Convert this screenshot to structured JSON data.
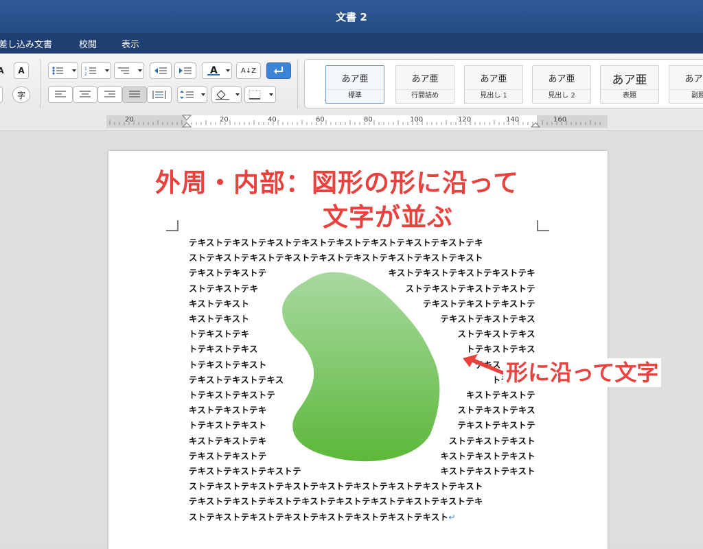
{
  "window": {
    "title": "文書 2"
  },
  "menu": {
    "tabs": [
      "差し込み文書",
      "校閲",
      "表示"
    ]
  },
  "ribbon": {
    "text_box_glyph": "A",
    "char_glyph": "字",
    "sort_glyph": "A↓Z"
  },
  "styles": [
    {
      "preview": "あア亜",
      "name": "標準",
      "selected": true
    },
    {
      "preview": "あア亜",
      "name": "行間詰め"
    },
    {
      "preview": "あア亜",
      "name": "見出し 1"
    },
    {
      "preview": "あア亜",
      "name": "見出し 2"
    },
    {
      "preview": "あア亜",
      "name": "表題"
    },
    {
      "preview": "あア亜",
      "name": "副題"
    }
  ],
  "ruler": {
    "numbers": [
      "20",
      "20",
      "40",
      "60",
      "80",
      "100",
      "120",
      "140",
      "160"
    ]
  },
  "document": {
    "heading_line1": "外周・内部：図形の形に沿って",
    "heading_line2": "文字が並ぶ",
    "shape_color_top": "#a8d9a0",
    "shape_color_bottom": "#5cb83a",
    "lines": [
      [
        "テキストテキストテキストテキストテキストテキストテキストテキストテキ",
        ""
      ],
      [
        "ストテキストテキストテキストテキストテキストテキストテキストテキスト",
        ""
      ],
      [
        "テキストテキストテ",
        "キストテキストテキストテキストテキ"
      ],
      [
        "ストテキストテキ",
        "ストテキストテキストテキストテ"
      ],
      [
        "キストテキスト",
        "テキストテキストテキストテ"
      ],
      [
        "キストテキスト",
        "テキストテキストテキス"
      ],
      [
        "トテキストテキ",
        "ストテキストテキス"
      ],
      [
        "トテキストテキス",
        "トテキストテキス"
      ],
      [
        "トテキストテキスト",
        "テキストテキス"
      ],
      [
        "テキストテキストテキス",
        "トテキスト"
      ],
      [
        "トテキストテキストテ",
        "キストテキストテ"
      ],
      [
        "キストテキストテキ",
        "ストテキストテキス"
      ],
      [
        "トテキストテキスト",
        "テキストテキストテ"
      ],
      [
        "キストテキストテキ",
        "ストテキストテキスト"
      ],
      [
        "テキストテキストテ",
        "キストテキストテキスト"
      ],
      [
        "テキストテキストテキストテ",
        "キストテキストテキスト"
      ],
      [
        "ストテキストテキストテキストテキストテキストテキストテキストテキスト",
        ""
      ],
      [
        "テキストテキストテキストテキストテキストテキストテキストテキストテキ",
        ""
      ],
      [
        "ストテキストテキストテキストテキストテキストテキストテキスト",
        ""
      ]
    ],
    "paragraph_mark": "↵"
  },
  "callout": {
    "text": "形に沿って文字",
    "color": "#e8423f"
  }
}
